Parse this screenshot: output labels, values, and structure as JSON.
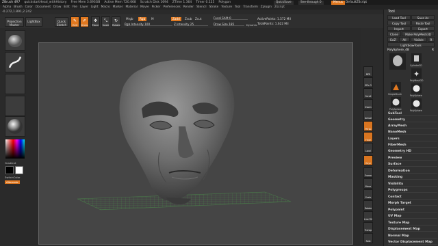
{
  "titlebar": {
    "app": "ZBrush 4R7",
    "file": "quickstartHead_withHistory",
    "free_mem": "Free Mem 3.693GB",
    "active_mem": "Active Mem 720.068",
    "scratch_disk": "Scratch Disk 1694",
    "ztime": "ZTime 1.364",
    "timer": "Timer 0.125",
    "poly_count": "Polygon",
    "quicksave": "QuickSave",
    "see_through": "See-through 0",
    "menus": "Menus",
    "default_script": "DefaultZScript"
  },
  "menubar": [
    "Alpha",
    "Brush",
    "Color",
    "Document",
    "Draw",
    "Edit",
    "File",
    "Layer",
    "Light",
    "Macro",
    "Marker",
    "Material",
    "Movie",
    "Picker",
    "Preferences",
    "Render",
    "Stencil",
    "Stroke",
    "Texture",
    "Tool",
    "Transform",
    "Zplugin",
    "Zscript"
  ],
  "coords": "-0.272,1.891,2.242",
  "top_shelf": {
    "projection_master": "Projection Master",
    "lightbox": "LightBox",
    "quick_sketch": "Quick Sketch",
    "edit": "Edit",
    "draw": "Draw",
    "move": "Move",
    "scale": "Scale",
    "rotate": "Rotate",
    "mrgb": "Mrgb",
    "rgb": "Rgb",
    "m": "M",
    "zadd": "Zadd",
    "zsub": "Zsub",
    "zcut": "Zcut",
    "rgb_intensity": "Rgb Intensity",
    "rgb_intensity_value": "100",
    "z_intensity": "Z Intensity",
    "z_intensity_value": "25",
    "focal_shift": "Focal Shift",
    "focal_shift_value": "0",
    "draw_size": "Draw Size",
    "draw_size_value": "185",
    "dynamic": "Dynamic",
    "active_points": "ActivePoints: 1.572  Mil",
    "total_points": "TotalPoints: 1.622  Mil"
  },
  "left_shelf": {
    "gradient": "Gradient",
    "switch_color": "SwitchColor",
    "alternate": "Alternate"
  },
  "right_shelf": [
    "BPR",
    "SPix 3",
    "",
    "Scroll",
    "Zoom",
    "Actual",
    "AAHalf",
    "Persp",
    "Floor",
    "Local",
    "LSym",
    "Gxyz",
    "Frame",
    "Move",
    "Scale",
    "Rotate",
    "Line Fill",
    "PolyF",
    "Transp",
    "Solo",
    "Xpose"
  ],
  "panel": {
    "title": "Tool",
    "load_tool": "Load Tool",
    "save_as": "Save As",
    "copy_tool": "Copy Tool",
    "paste_tool": "Paste Tool",
    "import": "Import",
    "export": "Export",
    "clone": "Clone",
    "make_polymesh": "Make PolyMesh3D",
    "goz": "GoZ",
    "all": "All",
    "visible": "Visible",
    "r": "R",
    "lightbox_tools": "Lightbox▸Tools",
    "current_tool": "PolySphere_48",
    "r_label": "R",
    "thumbs": [
      "PolySphere",
      "Cylinder3D",
      "PolyMesh3D",
      "SimpleBrush",
      "Sphere3D",
      "PolySphere",
      "PolySphere",
      "PolySphere"
    ],
    "menu_items": [
      "SubTool",
      "Geometry",
      "ArrayMesh",
      "NanoMesh",
      "Layers",
      "FiberMesh",
      "Geometry HD",
      "Preview",
      "Surface",
      "Deformation",
      "Masking",
      "Visibility",
      "Polygroups",
      "Contact",
      "Morph Target",
      "Polypaint",
      "UV Map",
      "Texture Map",
      "Displacement Map",
      "Normal Map",
      "Vector Displacement Map"
    ]
  },
  "colors": {
    "accent": "#e07820",
    "background": "#2a2a2a",
    "viewport": "#454545",
    "floor_grid": "#3a6a3a"
  }
}
